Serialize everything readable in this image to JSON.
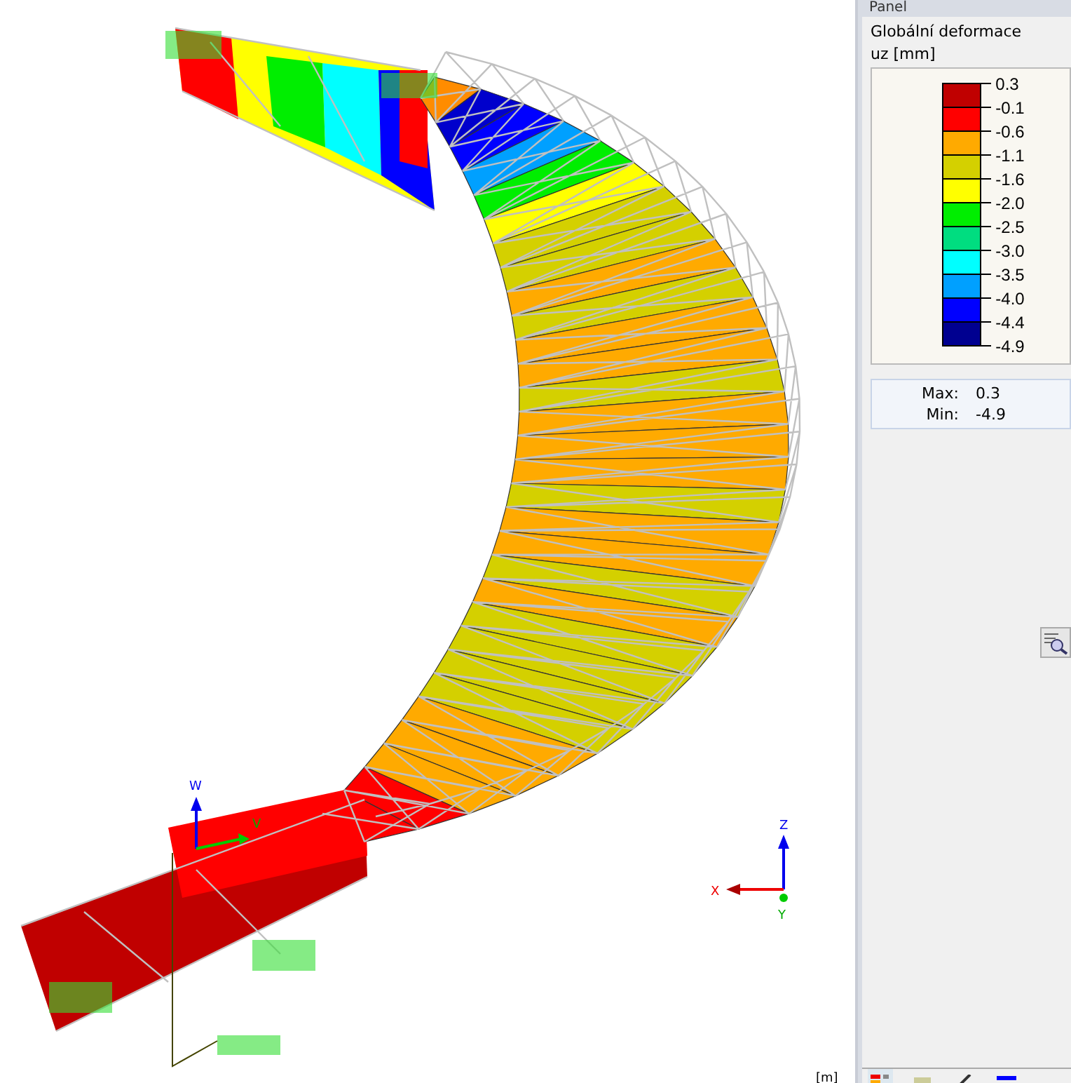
{
  "viewport": {
    "unit": "[m]",
    "local_axes": [
      "W",
      "V"
    ],
    "global_axes": [
      "Z",
      "X",
      "Y"
    ]
  },
  "panel": {
    "title": "Panel",
    "result": "Globální deformace",
    "quantity": "uz [mm]",
    "legend": {
      "ticks": [
        "0.3",
        "-0.1",
        "-0.6",
        "-1.1",
        "-1.6",
        "-2.0",
        "-2.5",
        "-3.0",
        "-3.5",
        "-4.0",
        "-4.4",
        "-4.9"
      ],
      "bands": [
        {
          "color": "#c00000"
        },
        {
          "color": "#ff0000"
        },
        {
          "color": "#ffaa00"
        },
        {
          "color": "#d4d000"
        },
        {
          "color": "#ffff00"
        },
        {
          "color": "#00ee00"
        },
        {
          "color": "#00dd80"
        },
        {
          "color": "#00ffff"
        },
        {
          "color": "#00a0ff"
        },
        {
          "color": "#0000ff"
        },
        {
          "color": "#000090"
        }
      ]
    },
    "summary": [
      {
        "label": "Max:",
        "value": "0.3"
      },
      {
        "label": "Min:",
        "value": "-4.9"
      }
    ]
  }
}
